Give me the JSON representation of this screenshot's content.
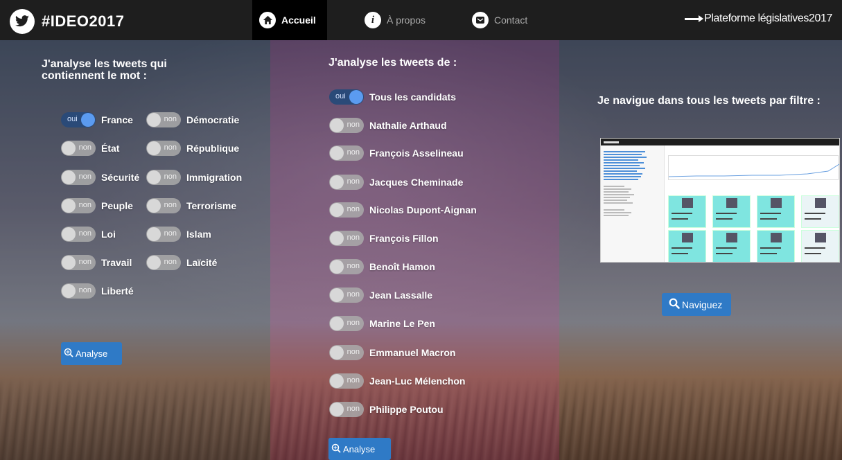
{
  "app": {
    "brand": "#IDEO2017",
    "brand_icon": "twitter-bird-icon",
    "platform_link": "Plateforme législatives2017"
  },
  "nav": {
    "items": [
      {
        "label": "Accueil",
        "icon": "home-icon",
        "active": true
      },
      {
        "label": "À propos",
        "icon": "info-icon",
        "active": false
      },
      {
        "label": "Contact",
        "icon": "mail-icon",
        "active": false
      }
    ]
  },
  "words_panel": {
    "heading": "J'analyse les tweets qui contiennent le mot :",
    "toggle_on_text": "oui",
    "toggle_off_text": "non",
    "words": [
      {
        "label": "France",
        "on": true
      },
      {
        "label": "Démocratie",
        "on": false
      },
      {
        "label": "État",
        "on": false
      },
      {
        "label": "République",
        "on": false
      },
      {
        "label": "Sécurité",
        "on": false
      },
      {
        "label": "Immigration",
        "on": false
      },
      {
        "label": "Peuple",
        "on": false
      },
      {
        "label": "Terrorisme",
        "on": false
      },
      {
        "label": "Loi",
        "on": false
      },
      {
        "label": "Islam",
        "on": false
      },
      {
        "label": "Travail",
        "on": false
      },
      {
        "label": "Laïcité",
        "on": false
      },
      {
        "label": "Liberté",
        "on": false
      }
    ],
    "button": "Analyse"
  },
  "candidates_panel": {
    "heading": "J'analyse les tweets de :",
    "candidates": [
      {
        "label": "Tous les candidats",
        "on": true
      },
      {
        "label": "Nathalie Arthaud",
        "on": false
      },
      {
        "label": "François Asselineau",
        "on": false
      },
      {
        "label": "Jacques Cheminade",
        "on": false
      },
      {
        "label": "Nicolas Dupont-Aignan",
        "on": false
      },
      {
        "label": "François Fillon",
        "on": false
      },
      {
        "label": "Benoît Hamon",
        "on": false
      },
      {
        "label": "Jean Lassalle",
        "on": false
      },
      {
        "label": "Marine Le Pen",
        "on": false
      },
      {
        "label": "Emmanuel Macron",
        "on": false
      },
      {
        "label": "Jean-Luc Mélenchon",
        "on": false
      },
      {
        "label": "Philippe Poutou",
        "on": false
      }
    ],
    "button": "Analyse"
  },
  "navigate_panel": {
    "heading": "Je navigue dans tous les tweets par filtre :",
    "button": "Naviguez",
    "button_icon": "search-icon"
  },
  "colors": {
    "navbar": "#1e1e1e",
    "button": "#2f7ac6",
    "toggle_on_knob": "#5b9bf0"
  }
}
